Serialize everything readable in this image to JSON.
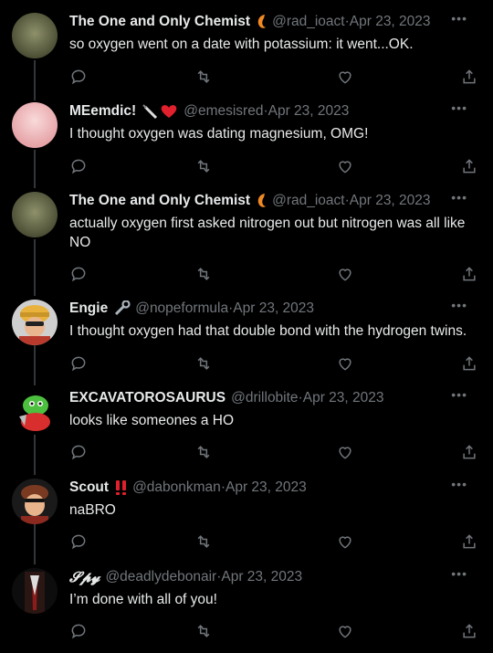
{
  "tweets": [
    {
      "name": "The One and Only Chemist",
      "handle": "@rad_ioact",
      "sep": " · ",
      "date": "Apr 23, 2023",
      "text": "so oxygen went on a date with potassium: it went...OK.",
      "badge": "atom-icon",
      "avatar_color": "#6b6e4f"
    },
    {
      "name": "MEemdic!",
      "handle": "@emesisred",
      "sep": " · ",
      "date": "Apr 23, 2023",
      "text": "I thought oxygen was dating magnesium, OMG!",
      "badge": "syringe-heart-icon",
      "avatar_color": "#f0c5c7"
    },
    {
      "name": "The One and Only Chemist",
      "handle": "@rad_ioact",
      "sep": " · ",
      "date": "Apr 23, 2023",
      "text": "actually oxygen first asked nitrogen out but nitrogen was all like NO",
      "badge": "atom-icon",
      "avatar_color": "#6b6e4f"
    },
    {
      "name": "Engie",
      "handle": "@nopeformula",
      "sep": " · ",
      "date": "Apr 23, 2023",
      "text": "I thought oxygen had that double bond with the hydrogen twins.",
      "badge": "wrench-icon",
      "avatar_color": "#e7b36a"
    },
    {
      "name": "EXCAVATOROSAURUS",
      "handle": "@drillobite",
      "sep": " · ",
      "date": "Apr 23, 2023",
      "text": "looks like someones a HO",
      "badge": "",
      "avatar_color": "#3ea53a"
    },
    {
      "name": "Scout",
      "handle": "@dabonkman",
      "sep": " · ",
      "date": "Apr 23, 2023",
      "text": "naBRO",
      "badge": "double-exclamation-icon",
      "avatar_color": "#8a4a2c"
    },
    {
      "name": "𝓢𝓹𝔂",
      "handle": "@deadlydebonair",
      "sep": " · ",
      "date": "Apr 23, 2023",
      "text": "I’m done with all of you!",
      "badge": "",
      "avatar_color": "#3a1f1a"
    }
  ],
  "more_label": "•••",
  "colors": {
    "background": "#000000",
    "text": "#e7e9ea",
    "muted": "#71767b",
    "line": "#333639"
  }
}
